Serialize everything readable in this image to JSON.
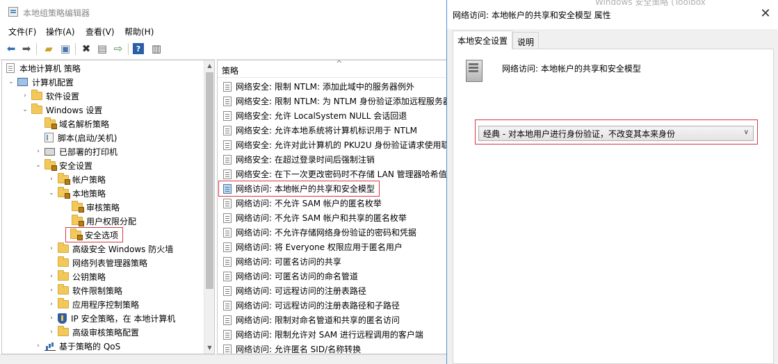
{
  "main_window": {
    "title": "本地组策略编辑器",
    "menu": [
      "文件(F)",
      "操作(A)",
      "查看(V)",
      "帮助(H)"
    ]
  },
  "tree": {
    "items": [
      {
        "label": "本地计算机 策略",
        "icon": "policy-doc-icon"
      },
      {
        "label": "计算机配置",
        "icon": "computer-icon"
      },
      {
        "label": "软件设置",
        "icon": "folder-icon"
      },
      {
        "label": "Windows 设置",
        "icon": "folder-icon"
      },
      {
        "label": "域名解析策略",
        "icon": "folder-locked-icon"
      },
      {
        "label": "脚本(启动/关机)",
        "icon": "script-icon"
      },
      {
        "label": "已部署的打印机",
        "icon": "printer-icon"
      },
      {
        "label": "安全设置",
        "icon": "security-icon"
      },
      {
        "label": "帐户策略",
        "icon": "folder-locked-icon"
      },
      {
        "label": "本地策略",
        "icon": "folder-locked-icon"
      },
      {
        "label": "审核策略",
        "icon": "folder-locked-icon"
      },
      {
        "label": "用户权限分配",
        "icon": "folder-locked-icon"
      },
      {
        "label": "安全选项",
        "icon": "folder-locked-icon"
      },
      {
        "label": "高级安全 Windows 防火墙",
        "icon": "folder-icon"
      },
      {
        "label": "网络列表管理器策略",
        "icon": "folder-icon"
      },
      {
        "label": "公钥策略",
        "icon": "folder-icon"
      },
      {
        "label": "软件限制策略",
        "icon": "folder-icon"
      },
      {
        "label": "应用程序控制策略",
        "icon": "folder-icon"
      },
      {
        "label": "IP 安全策略，在 本地计算机",
        "icon": "ip-security-icon"
      },
      {
        "label": "高级审核策略配置",
        "icon": "folder-icon"
      },
      {
        "label": "基于策略的 QoS",
        "icon": "qos-chart-icon"
      }
    ]
  },
  "list": {
    "column_header": "策略",
    "policies": [
      "网络安全: 限制 NTLM: 添加此域中的服务器例外",
      "网络安全: 限制 NTLM: 为 NTLM 身份验证添加远程服务器",
      "网络安全: 允许 LocalSystem NULL 会话回退",
      "网络安全: 允许本地系统将计算机标识用于 NTLM",
      "网络安全: 允许对此计算机的 PKU2U 身份验证请求使用联",
      "网络安全: 在超过登录时间后强制注销",
      "网络安全: 在下一次更改密码时不存储 LAN 管理器哈希值",
      "网络访问: 本地帐户的共享和安全模型",
      "网络访问: 不允许 SAM 帐户的匿名枚举",
      "网络访问: 不允许 SAM 帐户和共享的匿名枚举",
      "网络访问: 不允许存储网络身份验证的密码和凭据",
      "网络访问: 将 Everyone 权限应用于匿名用户",
      "网络访问: 可匿名访问的共享",
      "网络访问: 可匿名访问的命名管道",
      "网络访问: 可远程访问的注册表路径",
      "网络访问: 可远程访问的注册表路径和子路径",
      "网络访问: 限制对命名管道和共享的匿名访问",
      "网络访问: 限制允许对 SAM 进行远程调用的客户端",
      "网络访问: 允许匿名 SID/名称转换"
    ]
  },
  "dialog": {
    "title": "网络访问: 本地帐户的共享和安全模型 属性",
    "close_glyph": "✕",
    "tabs": [
      "本地安全设置",
      "说明"
    ],
    "policy_name": "网络访问: 本地帐户的共享和安全模型",
    "select_value": "经典 - 对本地用户进行身份验证，不改变其本来身份",
    "corner_text": "Windows 安全策略 (Toolbox"
  },
  "colors": {
    "highlight_border": "#d9363e",
    "dialog_border": "#4a90d9",
    "tab_background": "#f0f0f0"
  }
}
